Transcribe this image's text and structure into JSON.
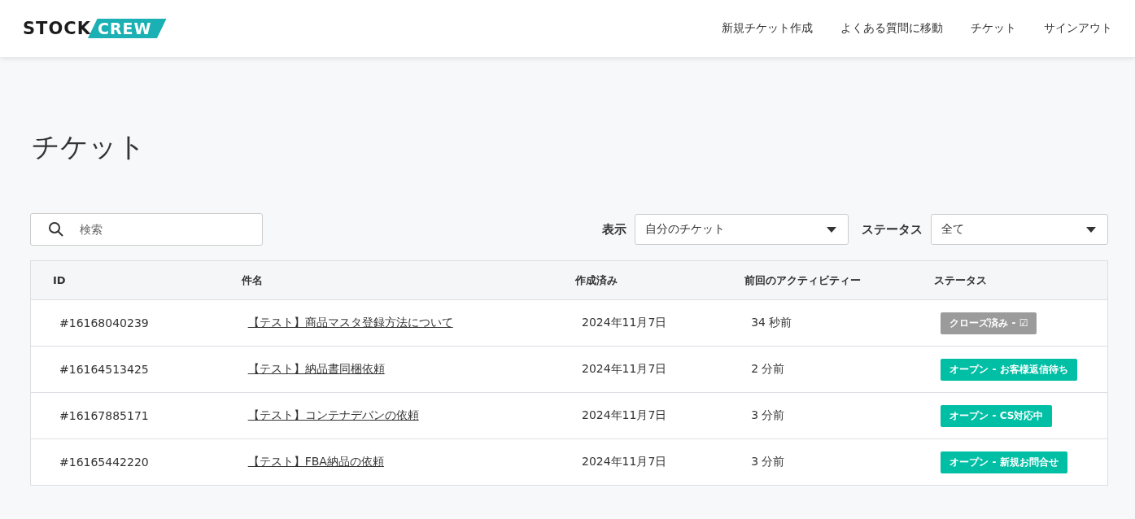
{
  "header": {
    "logo": {
      "left": "STOCK",
      "right": "CREW"
    },
    "nav": [
      "新規チケット作成",
      "よくある質問に移動",
      "チケット",
      "サインアウト"
    ]
  },
  "title": "チケット",
  "search": {
    "placeholder": "検索"
  },
  "filters": [
    {
      "label": "表示",
      "value": "自分のチケット"
    },
    {
      "label": "ステータス",
      "value": "全て"
    }
  ],
  "table": {
    "columns": [
      "ID",
      "件名",
      "作成済み",
      "前回のアクティビティー",
      "ステータス"
    ],
    "rows": [
      {
        "id": "#16168040239",
        "subject": "【テスト】商品マスタ登録方法について",
        "created": "2024年11月7日",
        "activity": "34 秒前",
        "status": {
          "kind": "closed",
          "label": "クローズ済み - ☑"
        }
      },
      {
        "id": "#16164513425",
        "subject": "【テスト】納品書同梱依頼",
        "created": "2024年11月7日",
        "activity": "2 分前",
        "status": {
          "kind": "open",
          "label": "オープン - お客様返信待ち"
        }
      },
      {
        "id": "#16167885171",
        "subject": "【テスト】コンテナデバンの依頼",
        "created": "2024年11月7日",
        "activity": "3 分前",
        "status": {
          "kind": "open",
          "label": "オープン - CS対応中"
        }
      },
      {
        "id": "#16165442220",
        "subject": "【テスト】FBA納品の依頼",
        "created": "2024年11月7日",
        "activity": "3 分前",
        "status": {
          "kind": "open",
          "label": "オープン - 新規お問合せ"
        }
      }
    ]
  }
}
